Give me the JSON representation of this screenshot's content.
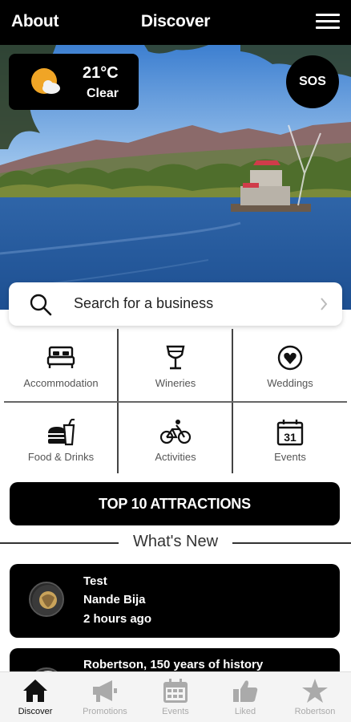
{
  "header": {
    "about_label": "About",
    "title": "Discover",
    "menu_icon": "hamburger-menu-icon"
  },
  "weather": {
    "temperature": "21°C",
    "condition": "Clear",
    "icon": "partly-cloudy-icon"
  },
  "sos_label": "SOS",
  "search": {
    "placeholder": "Search for a business"
  },
  "categories": [
    {
      "label": "Accommodation",
      "icon": "bed-icon"
    },
    {
      "label": "Wineries",
      "icon": "wine-glass-icon"
    },
    {
      "label": "Weddings",
      "icon": "heart-circle-icon"
    },
    {
      "label": "Food & Drinks",
      "icon": "burger-drink-icon"
    },
    {
      "label": "Activities",
      "icon": "cyclist-icon"
    },
    {
      "label": "Events",
      "icon": "calendar-31-icon"
    }
  ],
  "top_button_label": "TOP 10 ATTRACTIONS",
  "whats_new": {
    "heading": "What's New",
    "items": [
      {
        "title": "Test",
        "author": "Nande Bija",
        "time": "2 hours ago"
      },
      {
        "title": "Robertson, 150 years of history"
      }
    ]
  },
  "bottom_nav": [
    {
      "label": "Discover",
      "icon": "home-icon",
      "active": true
    },
    {
      "label": "Promotions",
      "icon": "megaphone-icon",
      "active": false
    },
    {
      "label": "Events",
      "icon": "calendar-icon",
      "active": false
    },
    {
      "label": "Liked",
      "icon": "thumbs-up-icon",
      "active": false
    },
    {
      "label": "Robertson",
      "icon": "star-icon",
      "active": false
    }
  ],
  "colors": {
    "bar": "#000000",
    "accent_text": "#ffffff",
    "inactive_nav": "#aaaaaa"
  }
}
